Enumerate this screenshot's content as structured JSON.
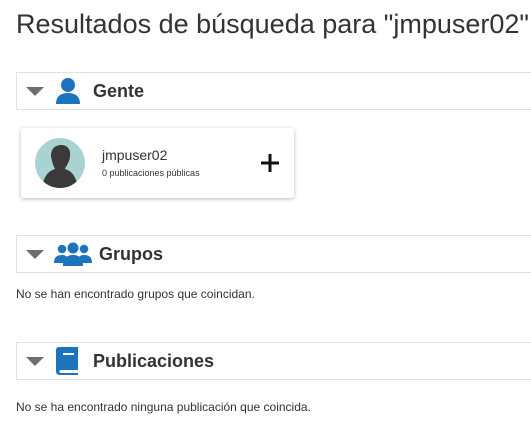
{
  "page": {
    "title": "Resultados de búsqueda para \"jmpuser02\""
  },
  "people_section": {
    "title": "Gente",
    "icon": "person-icon",
    "icon_color": "#1d74bd",
    "results": [
      {
        "username": "jmpuser02",
        "publications": "0 publicaciones públicas",
        "action_icon": "plus-icon"
      }
    ]
  },
  "groups_section": {
    "title": "Grupos",
    "icon": "group-icon",
    "icon_color": "#1d74bd",
    "empty_message": "No se han encontrado grupos que coincidan."
  },
  "publications_section": {
    "title": "Publicaciones",
    "icon": "book-icon",
    "icon_color": "#1d74bd",
    "empty_message": "No se ha encontrado ninguna publicación que coincida."
  }
}
